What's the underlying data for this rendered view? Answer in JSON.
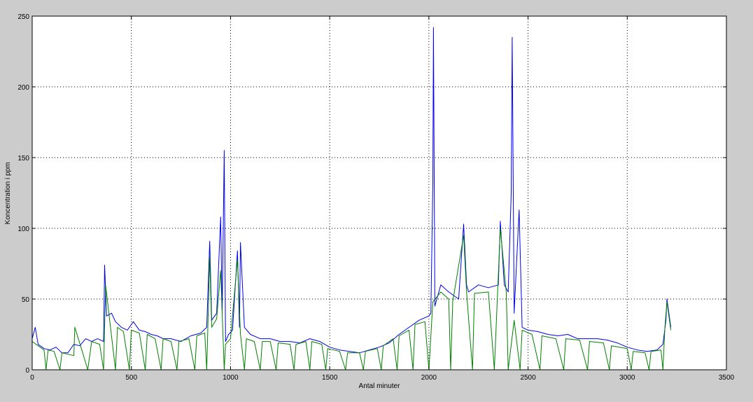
{
  "chart_data": {
    "type": "line",
    "title": "",
    "xlabel": "Antal minuter",
    "ylabel": "Koncentration i ppm",
    "xlim": [
      0,
      3500
    ],
    "ylim": [
      0,
      250
    ],
    "xticks": [
      0,
      500,
      1000,
      1500,
      2000,
      2500,
      3000,
      3500
    ],
    "yticks": [
      0,
      50,
      100,
      150,
      200,
      250
    ],
    "xtick_labels": [
      "0",
      "500",
      "1000",
      "1500",
      "2000",
      "2500",
      "3000",
      "3500"
    ],
    "ytick_labels": [
      "0",
      "50",
      "100",
      "150",
      "200",
      "250"
    ],
    "grid": true,
    "series": [
      {
        "color": "#0000ee",
        "points": [
          [
            0,
            22
          ],
          [
            15,
            30
          ],
          [
            30,
            18
          ],
          [
            60,
            15
          ],
          [
            90,
            14
          ],
          [
            120,
            16
          ],
          [
            150,
            12
          ],
          [
            180,
            12
          ],
          [
            210,
            18
          ],
          [
            240,
            17
          ],
          [
            270,
            22
          ],
          [
            300,
            20
          ],
          [
            330,
            22
          ],
          [
            360,
            20
          ],
          [
            365,
            74
          ],
          [
            375,
            38
          ],
          [
            400,
            40
          ],
          [
            420,
            34
          ],
          [
            450,
            30
          ],
          [
            480,
            28
          ],
          [
            510,
            34
          ],
          [
            540,
            28
          ],
          [
            570,
            27
          ],
          [
            600,
            25
          ],
          [
            630,
            24
          ],
          [
            660,
            22
          ],
          [
            700,
            22
          ],
          [
            750,
            20
          ],
          [
            800,
            24
          ],
          [
            850,
            26
          ],
          [
            880,
            30
          ],
          [
            895,
            91
          ],
          [
            905,
            35
          ],
          [
            930,
            40
          ],
          [
            950,
            108
          ],
          [
            958,
            40
          ],
          [
            968,
            155
          ],
          [
            975,
            20
          ],
          [
            990,
            25
          ],
          [
            1010,
            28
          ],
          [
            1035,
            84
          ],
          [
            1045,
            30
          ],
          [
            1050,
            90
          ],
          [
            1070,
            30
          ],
          [
            1100,
            25
          ],
          [
            1150,
            22
          ],
          [
            1200,
            22
          ],
          [
            1250,
            20
          ],
          [
            1300,
            20
          ],
          [
            1350,
            19
          ],
          [
            1400,
            22
          ],
          [
            1450,
            20
          ],
          [
            1500,
            16
          ],
          [
            1550,
            14
          ],
          [
            1600,
            13
          ],
          [
            1650,
            12
          ],
          [
            1700,
            14
          ],
          [
            1750,
            16
          ],
          [
            1800,
            19
          ],
          [
            1850,
            25
          ],
          [
            1900,
            30
          ],
          [
            1950,
            35
          ],
          [
            2000,
            38
          ],
          [
            2010,
            40
          ],
          [
            2020,
            132
          ],
          [
            2023,
            242
          ],
          [
            2030,
            45
          ],
          [
            2060,
            60
          ],
          [
            2100,
            55
          ],
          [
            2150,
            50
          ],
          [
            2175,
            103
          ],
          [
            2190,
            60
          ],
          [
            2200,
            55
          ],
          [
            2250,
            60
          ],
          [
            2300,
            58
          ],
          [
            2350,
            60
          ],
          [
            2360,
            105
          ],
          [
            2380,
            60
          ],
          [
            2400,
            55
          ],
          [
            2415,
            125
          ],
          [
            2420,
            235
          ],
          [
            2430,
            40
          ],
          [
            2455,
            113
          ],
          [
            2470,
            30
          ],
          [
            2500,
            28
          ],
          [
            2550,
            27
          ],
          [
            2600,
            25
          ],
          [
            2650,
            24
          ],
          [
            2700,
            25
          ],
          [
            2750,
            22
          ],
          [
            2800,
            22
          ],
          [
            2850,
            22
          ],
          [
            2900,
            21
          ],
          [
            2950,
            19
          ],
          [
            3000,
            16
          ],
          [
            3050,
            14
          ],
          [
            3100,
            13
          ],
          [
            3150,
            14
          ],
          [
            3180,
            18
          ],
          [
            3195,
            35
          ],
          [
            3200,
            50
          ],
          [
            3220,
            30
          ]
        ]
      },
      {
        "color": "#008000",
        "points": [
          [
            0,
            20
          ],
          [
            30,
            17
          ],
          [
            60,
            14
          ],
          [
            70,
            0
          ],
          [
            80,
            14
          ],
          [
            110,
            13
          ],
          [
            140,
            0
          ],
          [
            150,
            12
          ],
          [
            210,
            10
          ],
          [
            215,
            30
          ],
          [
            250,
            14
          ],
          [
            280,
            0
          ],
          [
            300,
            20
          ],
          [
            340,
            18
          ],
          [
            360,
            0
          ],
          [
            370,
            60
          ],
          [
            390,
            36
          ],
          [
            420,
            0
          ],
          [
            430,
            30
          ],
          [
            460,
            27
          ],
          [
            490,
            0
          ],
          [
            500,
            28
          ],
          [
            540,
            26
          ],
          [
            570,
            0
          ],
          [
            580,
            25
          ],
          [
            620,
            22
          ],
          [
            650,
            0
          ],
          [
            660,
            22
          ],
          [
            700,
            20
          ],
          [
            730,
            0
          ],
          [
            740,
            20
          ],
          [
            790,
            22
          ],
          [
            820,
            0
          ],
          [
            830,
            24
          ],
          [
            870,
            26
          ],
          [
            880,
            0
          ],
          [
            895,
            80
          ],
          [
            905,
            30
          ],
          [
            930,
            36
          ],
          [
            950,
            70
          ],
          [
            968,
            0
          ],
          [
            975,
            18
          ],
          [
            1000,
            22
          ],
          [
            1035,
            78
          ],
          [
            1050,
            25
          ],
          [
            1070,
            0
          ],
          [
            1080,
            22
          ],
          [
            1120,
            20
          ],
          [
            1150,
            0
          ],
          [
            1160,
            20
          ],
          [
            1200,
            20
          ],
          [
            1230,
            0
          ],
          [
            1240,
            19
          ],
          [
            1300,
            18
          ],
          [
            1320,
            0
          ],
          [
            1330,
            18
          ],
          [
            1380,
            20
          ],
          [
            1400,
            0
          ],
          [
            1410,
            20
          ],
          [
            1460,
            18
          ],
          [
            1480,
            0
          ],
          [
            1490,
            15
          ],
          [
            1550,
            13
          ],
          [
            1580,
            0
          ],
          [
            1590,
            12
          ],
          [
            1650,
            12
          ],
          [
            1670,
            0
          ],
          [
            1680,
            13
          ],
          [
            1740,
            15
          ],
          [
            1760,
            0
          ],
          [
            1770,
            17
          ],
          [
            1820,
            22
          ],
          [
            1840,
            0
          ],
          [
            1850,
            24
          ],
          [
            1900,
            28
          ],
          [
            1920,
            0
          ],
          [
            1930,
            32
          ],
          [
            1980,
            34
          ],
          [
            2000,
            0
          ],
          [
            2020,
            48
          ],
          [
            2060,
            55
          ],
          [
            2100,
            50
          ],
          [
            2110,
            0
          ],
          [
            2120,
            48
          ],
          [
            2175,
            95
          ],
          [
            2190,
            55
          ],
          [
            2220,
            0
          ],
          [
            2230,
            54
          ],
          [
            2300,
            55
          ],
          [
            2330,
            0
          ],
          [
            2360,
            100
          ],
          [
            2390,
            55
          ],
          [
            2400,
            0
          ],
          [
            2430,
            35
          ],
          [
            2460,
            0
          ],
          [
            2470,
            28
          ],
          [
            2520,
            25
          ],
          [
            2560,
            0
          ],
          [
            2570,
            24
          ],
          [
            2640,
            22
          ],
          [
            2680,
            0
          ],
          [
            2690,
            22
          ],
          [
            2760,
            21
          ],
          [
            2800,
            0
          ],
          [
            2810,
            20
          ],
          [
            2880,
            19
          ],
          [
            2910,
            0
          ],
          [
            2920,
            17
          ],
          [
            3000,
            15
          ],
          [
            3020,
            0
          ],
          [
            3030,
            13
          ],
          [
            3090,
            12
          ],
          [
            3110,
            0
          ],
          [
            3120,
            13
          ],
          [
            3170,
            14
          ],
          [
            3180,
            0
          ],
          [
            3190,
            30
          ],
          [
            3200,
            48
          ],
          [
            3220,
            28
          ]
        ]
      }
    ]
  }
}
